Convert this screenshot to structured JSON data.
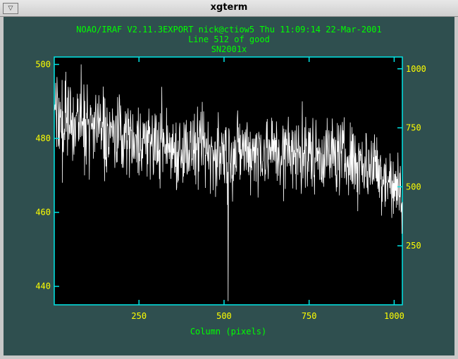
{
  "window": {
    "title": "xgterm",
    "menu_icon": "triangle-down-icon"
  },
  "plot": {
    "header": "NOAO/IRAF V2.11.3EXPORT nick@ctiow5 Thu 11:09:14 22-Mar-2001",
    "subtitle": "Line 512 of good",
    "object": "SN2001x",
    "xlabel": "Column (pixels)",
    "colors": {
      "background": "#2f4f4f",
      "plot_area": "#000000",
      "frame": "#00e5e5",
      "header_text": "#00ff00",
      "tick_labels": "#ffff00",
      "trace": "#ffffff"
    }
  },
  "chart_data": {
    "type": "line",
    "xlabel": "Column (pixels)",
    "xlim": [
      1,
      1024
    ],
    "ylim": [
      435,
      502
    ],
    "y2lim": [
      0,
      1050
    ],
    "x_ticks": [
      "250",
      "500",
      "750",
      "1000"
    ],
    "y_ticks": [
      "440",
      "460",
      "480",
      "500"
    ],
    "y2_ticks": [
      "250",
      "500",
      "750",
      "1000"
    ],
    "x_tick_values": [
      250,
      500,
      750,
      1000
    ],
    "y_tick_values": [
      440,
      460,
      480,
      500
    ],
    "y2_tick_values": [
      250,
      500,
      750,
      1000
    ],
    "trend": {
      "x": [
        1,
        50,
        100,
        150,
        200,
        250,
        300,
        350,
        400,
        450,
        500,
        550,
        600,
        650,
        700,
        750,
        800,
        850,
        900,
        925,
        950,
        975,
        1000,
        1024
      ],
      "y": [
        486,
        484,
        483,
        482,
        481,
        480,
        478.5,
        477.5,
        477,
        476,
        476,
        477,
        477,
        476.5,
        476,
        476,
        476,
        475,
        474,
        473,
        472,
        470,
        466,
        466
      ]
    },
    "noise_amplitude": 5,
    "spikes": [
      {
        "x": 5,
        "y": 495
      },
      {
        "x": 25,
        "y": 468
      },
      {
        "x": 35,
        "y": 498
      },
      {
        "x": 80,
        "y": 500
      },
      {
        "x": 90,
        "y": 470
      },
      {
        "x": 145,
        "y": 494
      },
      {
        "x": 250,
        "y": 470
      },
      {
        "x": 360,
        "y": 466
      },
      {
        "x": 460,
        "y": 465
      },
      {
        "x": 510,
        "y": 462
      },
      {
        "x": 512,
        "y": 436
      },
      {
        "x": 600,
        "y": 464
      },
      {
        "x": 675,
        "y": 463
      },
      {
        "x": 730,
        "y": 490
      },
      {
        "x": 745,
        "y": 467
      },
      {
        "x": 1000,
        "y": 463
      },
      {
        "x": 1010,
        "y": 462
      }
    ]
  }
}
